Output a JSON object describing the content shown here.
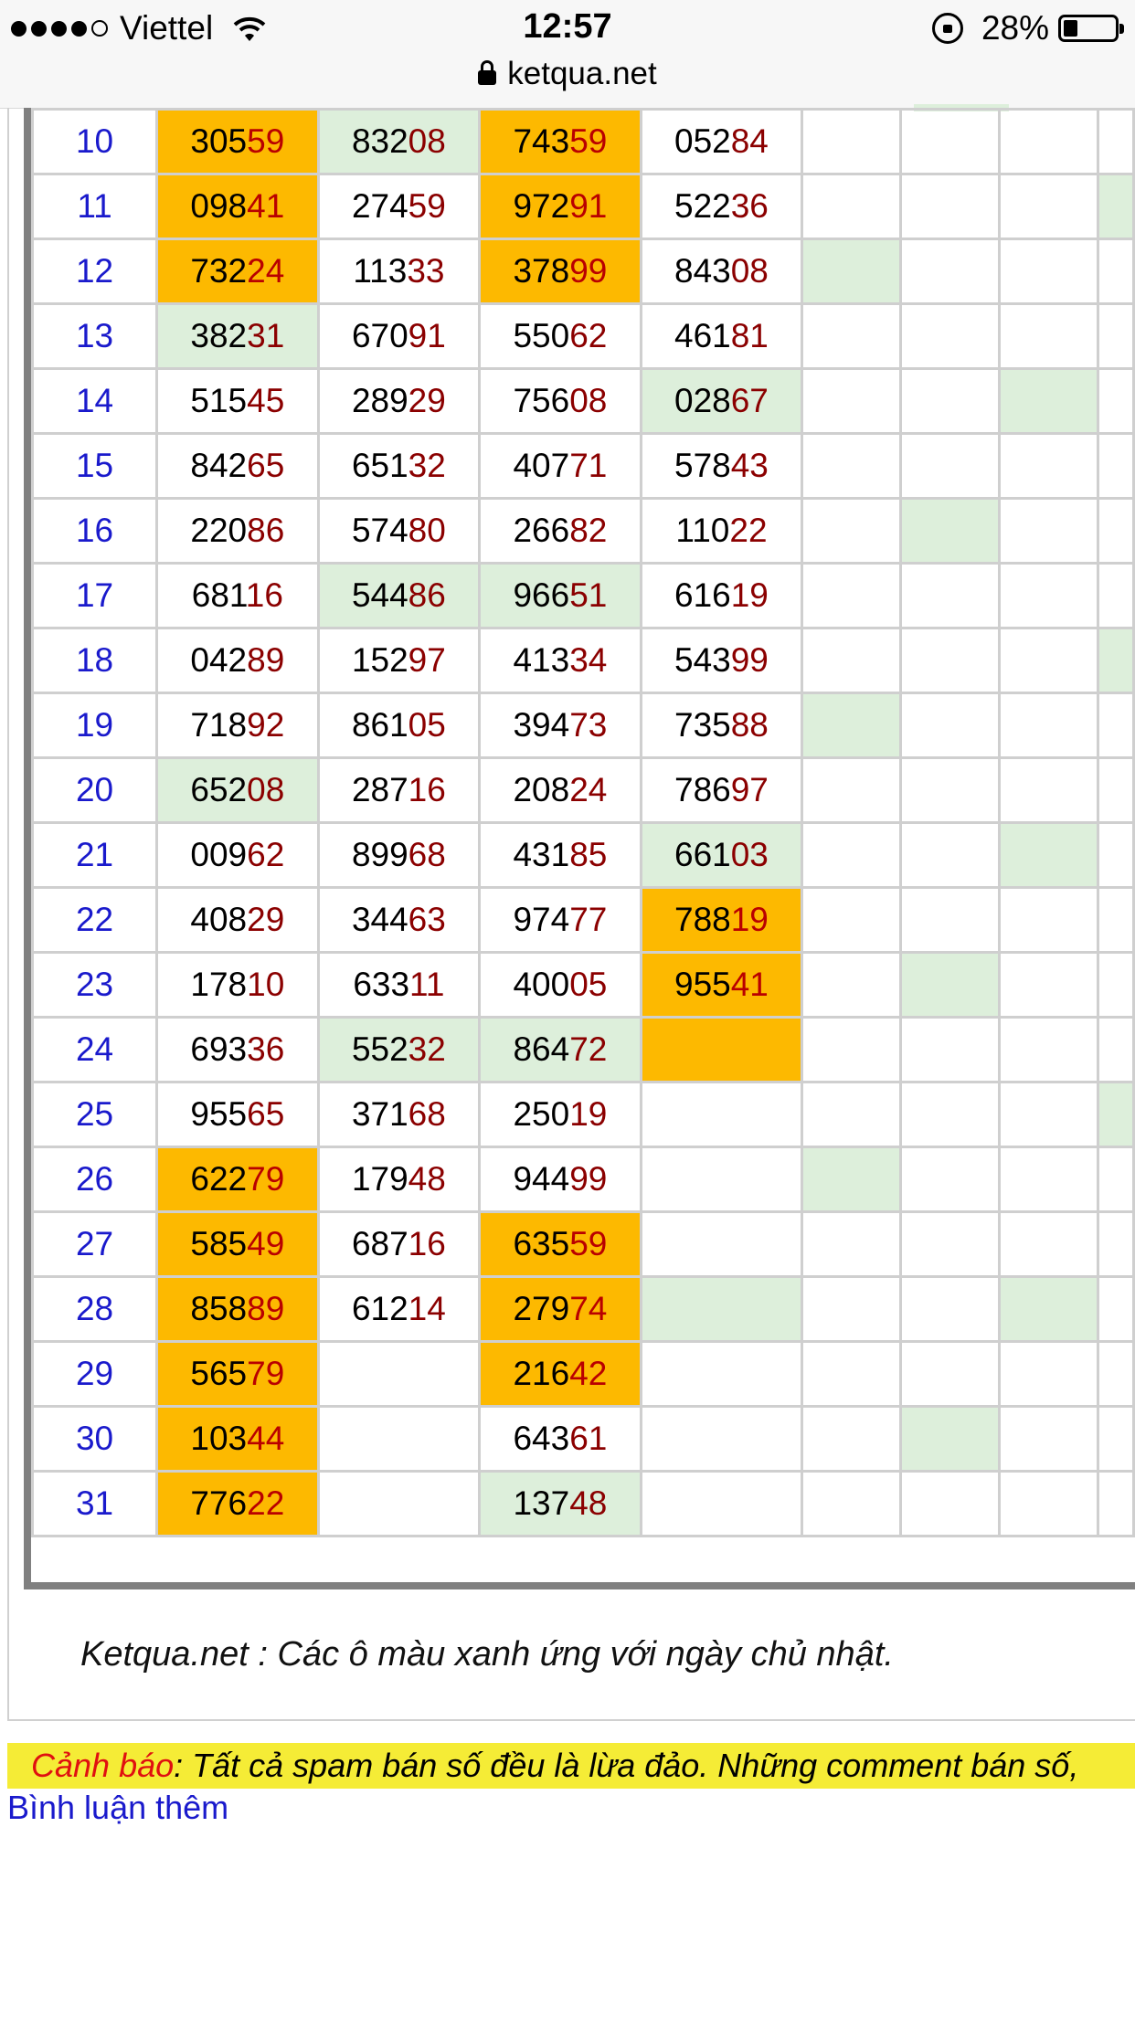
{
  "status": {
    "carrier": "Viettel",
    "time": "12:57",
    "battery": "28%",
    "battery_level": 0.28,
    "url": "ketqua.net"
  },
  "rows": [
    {
      "day": "10",
      "cells": [
        {
          "hi": "305",
          "lo": "59",
          "bg": "o"
        },
        {
          "hi": "832",
          "lo": "08",
          "bg": "g"
        },
        {
          "hi": "743",
          "lo": "59",
          "bg": "o"
        },
        {
          "hi": "052",
          "lo": "84",
          "bg": ""
        }
      ],
      "ext": [
        "",
        "",
        "",
        ""
      ]
    },
    {
      "day": "11",
      "cells": [
        {
          "hi": "098",
          "lo": "41",
          "bg": "o"
        },
        {
          "hi": "274",
          "lo": "59",
          "bg": ""
        },
        {
          "hi": "972",
          "lo": "91",
          "bg": "o"
        },
        {
          "hi": "522",
          "lo": "36",
          "bg": ""
        }
      ],
      "ext": [
        "",
        "",
        "",
        "g"
      ]
    },
    {
      "day": "12",
      "cells": [
        {
          "hi": "732",
          "lo": "24",
          "bg": "o"
        },
        {
          "hi": "113",
          "lo": "33",
          "bg": ""
        },
        {
          "hi": "378",
          "lo": "99",
          "bg": "o"
        },
        {
          "hi": "843",
          "lo": "08",
          "bg": ""
        }
      ],
      "ext": [
        "g",
        "",
        "",
        ""
      ]
    },
    {
      "day": "13",
      "cells": [
        {
          "hi": "382",
          "lo": "31",
          "bg": "g"
        },
        {
          "hi": "670",
          "lo": "91",
          "bg": ""
        },
        {
          "hi": "550",
          "lo": "62",
          "bg": ""
        },
        {
          "hi": "461",
          "lo": "81",
          "bg": ""
        }
      ],
      "ext": [
        "",
        "",
        "",
        ""
      ]
    },
    {
      "day": "14",
      "cells": [
        {
          "hi": "515",
          "lo": "45",
          "bg": ""
        },
        {
          "hi": "289",
          "lo": "29",
          "bg": ""
        },
        {
          "hi": "756",
          "lo": "08",
          "bg": ""
        },
        {
          "hi": "028",
          "lo": "67",
          "bg": "g"
        }
      ],
      "ext": [
        "",
        "",
        "g",
        ""
      ]
    },
    {
      "day": "15",
      "cells": [
        {
          "hi": "842",
          "lo": "65",
          "bg": ""
        },
        {
          "hi": "651",
          "lo": "32",
          "bg": ""
        },
        {
          "hi": "407",
          "lo": "71",
          "bg": ""
        },
        {
          "hi": "578",
          "lo": "43",
          "bg": ""
        }
      ],
      "ext": [
        "",
        "",
        "",
        ""
      ]
    },
    {
      "day": "16",
      "cells": [
        {
          "hi": "220",
          "lo": "86",
          "bg": ""
        },
        {
          "hi": "574",
          "lo": "80",
          "bg": ""
        },
        {
          "hi": "266",
          "lo": "82",
          "bg": ""
        },
        {
          "hi": "110",
          "lo": "22",
          "bg": ""
        }
      ],
      "ext": [
        "",
        "g",
        "",
        ""
      ]
    },
    {
      "day": "17",
      "cells": [
        {
          "hi": "681",
          "lo": "16",
          "bg": ""
        },
        {
          "hi": "544",
          "lo": "86",
          "bg": "g"
        },
        {
          "hi": "966",
          "lo": "51",
          "bg": "g"
        },
        {
          "hi": "616",
          "lo": "19",
          "bg": ""
        }
      ],
      "ext": [
        "",
        "",
        "",
        ""
      ]
    },
    {
      "day": "18",
      "cells": [
        {
          "hi": "042",
          "lo": "89",
          "bg": ""
        },
        {
          "hi": "152",
          "lo": "97",
          "bg": ""
        },
        {
          "hi": "413",
          "lo": "34",
          "bg": ""
        },
        {
          "hi": "543",
          "lo": "99",
          "bg": ""
        }
      ],
      "ext": [
        "",
        "",
        "",
        "g"
      ]
    },
    {
      "day": "19",
      "cells": [
        {
          "hi": "718",
          "lo": "92",
          "bg": ""
        },
        {
          "hi": "861",
          "lo": "05",
          "bg": ""
        },
        {
          "hi": "394",
          "lo": "73",
          "bg": ""
        },
        {
          "hi": "735",
          "lo": "88",
          "bg": ""
        }
      ],
      "ext": [
        "g",
        "",
        "",
        ""
      ]
    },
    {
      "day": "20",
      "cells": [
        {
          "hi": "652",
          "lo": "08",
          "bg": "g"
        },
        {
          "hi": "287",
          "lo": "16",
          "bg": ""
        },
        {
          "hi": "208",
          "lo": "24",
          "bg": ""
        },
        {
          "hi": "786",
          "lo": "97",
          "bg": ""
        }
      ],
      "ext": [
        "",
        "",
        "",
        ""
      ]
    },
    {
      "day": "21",
      "cells": [
        {
          "hi": "009",
          "lo": "62",
          "bg": ""
        },
        {
          "hi": "899",
          "lo": "68",
          "bg": ""
        },
        {
          "hi": "431",
          "lo": "85",
          "bg": ""
        },
        {
          "hi": "661",
          "lo": "03",
          "bg": "g"
        }
      ],
      "ext": [
        "",
        "",
        "g",
        ""
      ]
    },
    {
      "day": "22",
      "cells": [
        {
          "hi": "408",
          "lo": "29",
          "bg": ""
        },
        {
          "hi": "344",
          "lo": "63",
          "bg": ""
        },
        {
          "hi": "974",
          "lo": "77",
          "bg": ""
        },
        {
          "hi": "788",
          "lo": "19",
          "bg": "o"
        }
      ],
      "ext": [
        "",
        "",
        "",
        ""
      ]
    },
    {
      "day": "23",
      "cells": [
        {
          "hi": "178",
          "lo": "10",
          "bg": ""
        },
        {
          "hi": "633",
          "lo": "11",
          "bg": ""
        },
        {
          "hi": "400",
          "lo": "05",
          "bg": ""
        },
        {
          "hi": "955",
          "lo": "41",
          "bg": "o"
        }
      ],
      "ext": [
        "",
        "g",
        "",
        ""
      ]
    },
    {
      "day": "24",
      "cells": [
        {
          "hi": "693",
          "lo": "36",
          "bg": ""
        },
        {
          "hi": "552",
          "lo": "32",
          "bg": "g"
        },
        {
          "hi": "864",
          "lo": "72",
          "bg": "g"
        },
        {
          "hi": "",
          "lo": "",
          "bg": "o"
        }
      ],
      "ext": [
        "",
        "",
        "",
        ""
      ]
    },
    {
      "day": "25",
      "cells": [
        {
          "hi": "955",
          "lo": "65",
          "bg": ""
        },
        {
          "hi": "371",
          "lo": "68",
          "bg": ""
        },
        {
          "hi": "250",
          "lo": "19",
          "bg": ""
        },
        {
          "hi": "",
          "lo": "",
          "bg": ""
        }
      ],
      "ext": [
        "",
        "",
        "",
        "g"
      ]
    },
    {
      "day": "26",
      "cells": [
        {
          "hi": "622",
          "lo": "79",
          "bg": "o"
        },
        {
          "hi": "179",
          "lo": "48",
          "bg": ""
        },
        {
          "hi": "944",
          "lo": "99",
          "bg": ""
        },
        {
          "hi": "",
          "lo": "",
          "bg": ""
        }
      ],
      "ext": [
        "g",
        "",
        "",
        ""
      ]
    },
    {
      "day": "27",
      "cells": [
        {
          "hi": "585",
          "lo": "49",
          "bg": "o"
        },
        {
          "hi": "687",
          "lo": "16",
          "bg": ""
        },
        {
          "hi": "635",
          "lo": "59",
          "bg": "o"
        },
        {
          "hi": "",
          "lo": "",
          "bg": ""
        }
      ],
      "ext": [
        "",
        "",
        "",
        ""
      ]
    },
    {
      "day": "28",
      "cells": [
        {
          "hi": "858",
          "lo": "89",
          "bg": "o"
        },
        {
          "hi": "612",
          "lo": "14",
          "bg": ""
        },
        {
          "hi": "279",
          "lo": "74",
          "bg": "o"
        },
        {
          "hi": "",
          "lo": "",
          "bg": "g"
        }
      ],
      "ext": [
        "",
        "",
        "g",
        ""
      ]
    },
    {
      "day": "29",
      "cells": [
        {
          "hi": "565",
          "lo": "79",
          "bg": "o"
        },
        {
          "hi": "",
          "lo": "",
          "bg": ""
        },
        {
          "hi": "216",
          "lo": "42",
          "bg": "o"
        },
        {
          "hi": "",
          "lo": "",
          "bg": ""
        }
      ],
      "ext": [
        "",
        "",
        "",
        ""
      ]
    },
    {
      "day": "30",
      "cells": [
        {
          "hi": "103",
          "lo": "44",
          "bg": "o"
        },
        {
          "hi": "",
          "lo": "",
          "bg": ""
        },
        {
          "hi": "643",
          "lo": "61",
          "bg": ""
        },
        {
          "hi": "",
          "lo": "",
          "bg": ""
        }
      ],
      "ext": [
        "",
        "g",
        "",
        ""
      ]
    },
    {
      "day": "31",
      "cells": [
        {
          "hi": "776",
          "lo": "22",
          "bg": "o"
        },
        {
          "hi": "",
          "lo": "",
          "bg": ""
        },
        {
          "hi": "137",
          "lo": "48",
          "bg": "g"
        },
        {
          "hi": "",
          "lo": "",
          "bg": ""
        }
      ],
      "ext": [
        "",
        "",
        "",
        ""
      ]
    }
  ],
  "note": "Ketqua.net : Các ô màu xanh ứng với ngày chủ nhật.",
  "warning": {
    "label": "Cảnh báo",
    "text": ": Tất cả spam bán số đều là lừa đảo. Những comment bán số,"
  },
  "more_comments": "Bình luận thêm",
  "colors": {
    "green": "#ddefdb",
    "orange": "#fdb900",
    "day_blue": "#1a1acc",
    "low_digits": "#8b0000",
    "warning_bg": "#f5ec36",
    "warning_label": "#e01010"
  }
}
